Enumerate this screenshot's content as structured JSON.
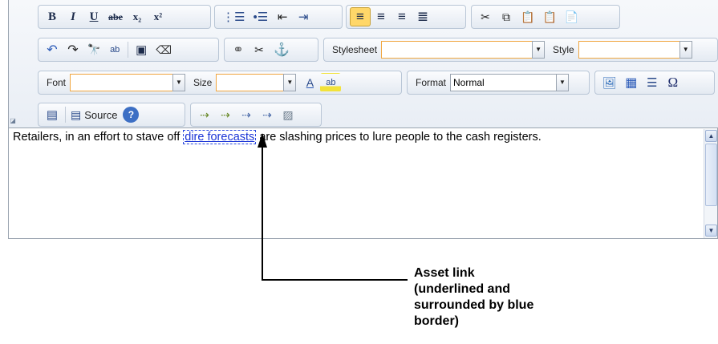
{
  "toolbar": {
    "row1": {
      "bold": "B",
      "italic": "I",
      "underline": "U",
      "strike": "abe",
      "subscript": "x₂",
      "superscript": "x²",
      "numbered_list": "⋮☰",
      "bullet_list": "•☰",
      "outdent": "⇤",
      "indent": "⇥",
      "align_left": "≡",
      "align_center": "≡",
      "align_right": "≡",
      "justify": "≣",
      "cut": "✂",
      "copy": "⧉",
      "paste": "📋",
      "paste_text": "📋",
      "paste_word": "📄"
    },
    "row2": {
      "undo": "↶",
      "redo": "↷",
      "find": "🔭",
      "replace": "ab",
      "select_all": "▣",
      "remove_format": "⌫",
      "link": "⚭",
      "unlink": "✂",
      "anchor": "⚓",
      "stylesheet_label": "Stylesheet",
      "stylesheet_value": "",
      "style_label": "Style",
      "style_value": ""
    },
    "row3": {
      "font_label": "Font",
      "font_value": "",
      "size_label": "Size",
      "size_value": "",
      "text_color": "A",
      "bg_color": "ab",
      "format_label": "Format",
      "format_value": "Normal",
      "image": "🖼",
      "table": "▦",
      "hr": "☰",
      "special_char": "Ω"
    },
    "row4": {
      "preview": "▤",
      "source_icon": "▤",
      "source_label": "Source",
      "help": "?",
      "asset1": "⇢",
      "asset2": "⇢",
      "asset3": "⇢",
      "asset4": "⇢",
      "asset5": "▨"
    },
    "collapse": "◪"
  },
  "content": {
    "before_link": "Retailers, in an effort to stave off ",
    "link_text": "dire forecasts",
    "after_link": " are slashing prices to lure people to the cash registers."
  },
  "scrollbar": {
    "up": "▲",
    "down": "▼"
  },
  "callout": {
    "text_line1": "Asset link",
    "text_line2": "(underlined and",
    "text_line3": "surrounded by blue",
    "text_line4": "border)"
  }
}
